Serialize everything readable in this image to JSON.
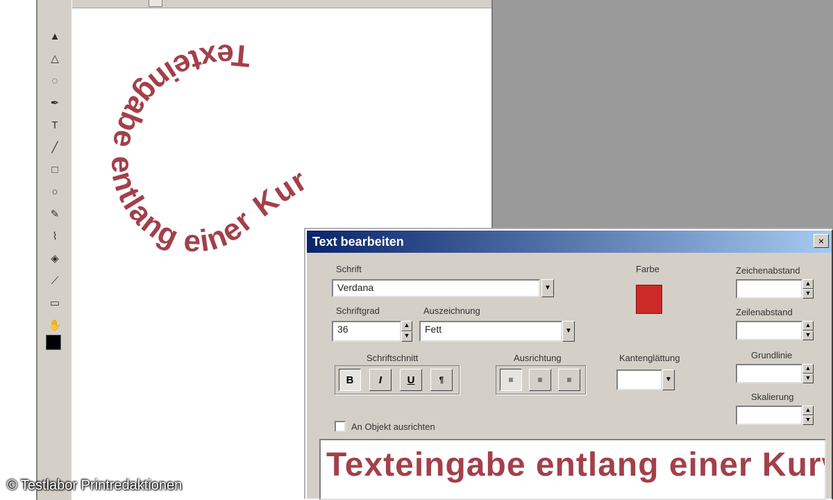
{
  "canvas": {
    "curved_text": "Texteingabe entlang einer Kur",
    "text_color": "#a3404a"
  },
  "toolbox": {
    "tools": [
      "selection-arrow-icon",
      "direct-select-icon",
      "lasso-icon",
      "pen-icon",
      "text-icon",
      "line-icon",
      "rectangle-icon",
      "ellipse-icon",
      "pencil-icon",
      "brush-icon",
      "bucket-icon",
      "eyedropper-icon",
      "eraser-icon",
      "hand-icon",
      "zoom-icon"
    ],
    "foreground_color": "#000000"
  },
  "dialog": {
    "title": "Text bearbeiten",
    "font_label": "Schrift",
    "font_value": "Verdana",
    "size_label": "Schriftgrad",
    "size_value": "36",
    "style_label": "Auszeichnung",
    "style_value": "Fett",
    "color_label": "Farbe",
    "color_value": "#cc2a26",
    "format_label": "Schriftschnitt",
    "align_label": "Ausrichtung",
    "anti_alias_label": "Kantenglättung",
    "spacing_label": "Zeichenabstand",
    "line_spacing_label": "Zeilenabstand",
    "baseline_label": "Grundlinie",
    "scale_label": "Skalierung",
    "checkbox_label": "An Objekt ausrichten",
    "preview_text": "Texteingabe entlang einer Kurve",
    "preview_color": "#a3404a",
    "bold_btn": "B",
    "italic_btn": "I",
    "underline_btn": "U",
    "close_glyph": "×"
  },
  "watermark": "© Testlabor Printredaktionen"
}
